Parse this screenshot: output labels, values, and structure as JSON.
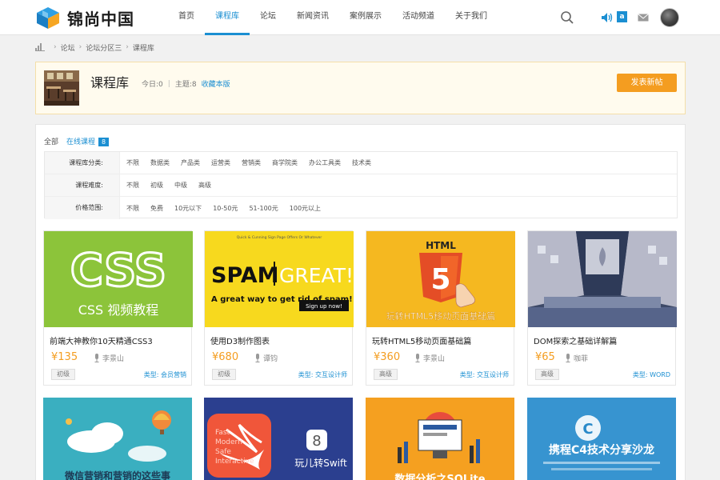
{
  "header": {
    "logo_text": "锦尚中国",
    "nav": [
      "首页",
      "课程库",
      "论坛",
      "新闻资讯",
      "案例展示",
      "活动频道",
      "关于我们"
    ],
    "active_nav": 1,
    "a_badge": "a",
    "accent": "#1b8fd2"
  },
  "breadcrumb": [
    "论坛",
    "论坛分区三",
    "课程库"
  ],
  "forum": {
    "name": "课程库",
    "today": "今日:0",
    "topics": "主题:8",
    "fav": "收藏本版",
    "post_button": "发表新帖"
  },
  "tabs": {
    "all": "全部",
    "online": "在线课程",
    "count": "8"
  },
  "filters": [
    {
      "label": "课程库分类:",
      "options": [
        "不限",
        "数据类",
        "产品类",
        "运营类",
        "营销类",
        "商学院类",
        "办公工具类",
        "技术类"
      ]
    },
    {
      "label": "课程难度:",
      "options": [
        "不限",
        "初级",
        "中级",
        "高级"
      ]
    },
    {
      "label": "价格范围:",
      "options": [
        "不限",
        "免费",
        "10元以下",
        "10-50元",
        "51-100元",
        "100元以上"
      ]
    }
  ],
  "cards": [
    {
      "title": "前端大神教你10天精通CSS3",
      "price": "¥135",
      "teacher": "李景山",
      "level": "初级",
      "type": "类型: 会员营销",
      "img_text_big": "CSS",
      "img_text_small": "CSS 视频教程"
    },
    {
      "title": "使用D3制作图表",
      "price": "¥680",
      "teacher": "谭钧",
      "level": "初级",
      "type": "类型: 交互设计师",
      "img_text_top": "Quick & Cunning Sign Page Offers Or Whatever",
      "img_text_big1": "SPAM",
      "img_text_big2": "GREAT!",
      "img_text_small": "A great way to get rid of spam!",
      "img_btn": "Sign up now!"
    },
    {
      "title": "玩转HTML5移动页面基础篇",
      "price": "¥360",
      "teacher": "李景山",
      "level": "高级",
      "type": "类型: 交互设计师",
      "img_label": "HTML",
      "img_caption": "玩转HTML5移动页面基础篇"
    },
    {
      "title": "DOM探索之基础详解篇",
      "price": "¥65",
      "teacher": "咖菲",
      "level": "高级",
      "type": "类型: WORD"
    }
  ],
  "cards_row2": [
    {
      "img_caption": "微信营销和营销的这些事"
    },
    {
      "img_text1": "Fast",
      "img_text2": "Modern",
      "img_text3": "Safe",
      "img_text4": "Interactive",
      "img_caption": "玩儿转Swift"
    },
    {
      "img_caption": "数据分析之SQLite"
    },
    {
      "img_caption": "携程C4技术分享沙龙"
    }
  ]
}
